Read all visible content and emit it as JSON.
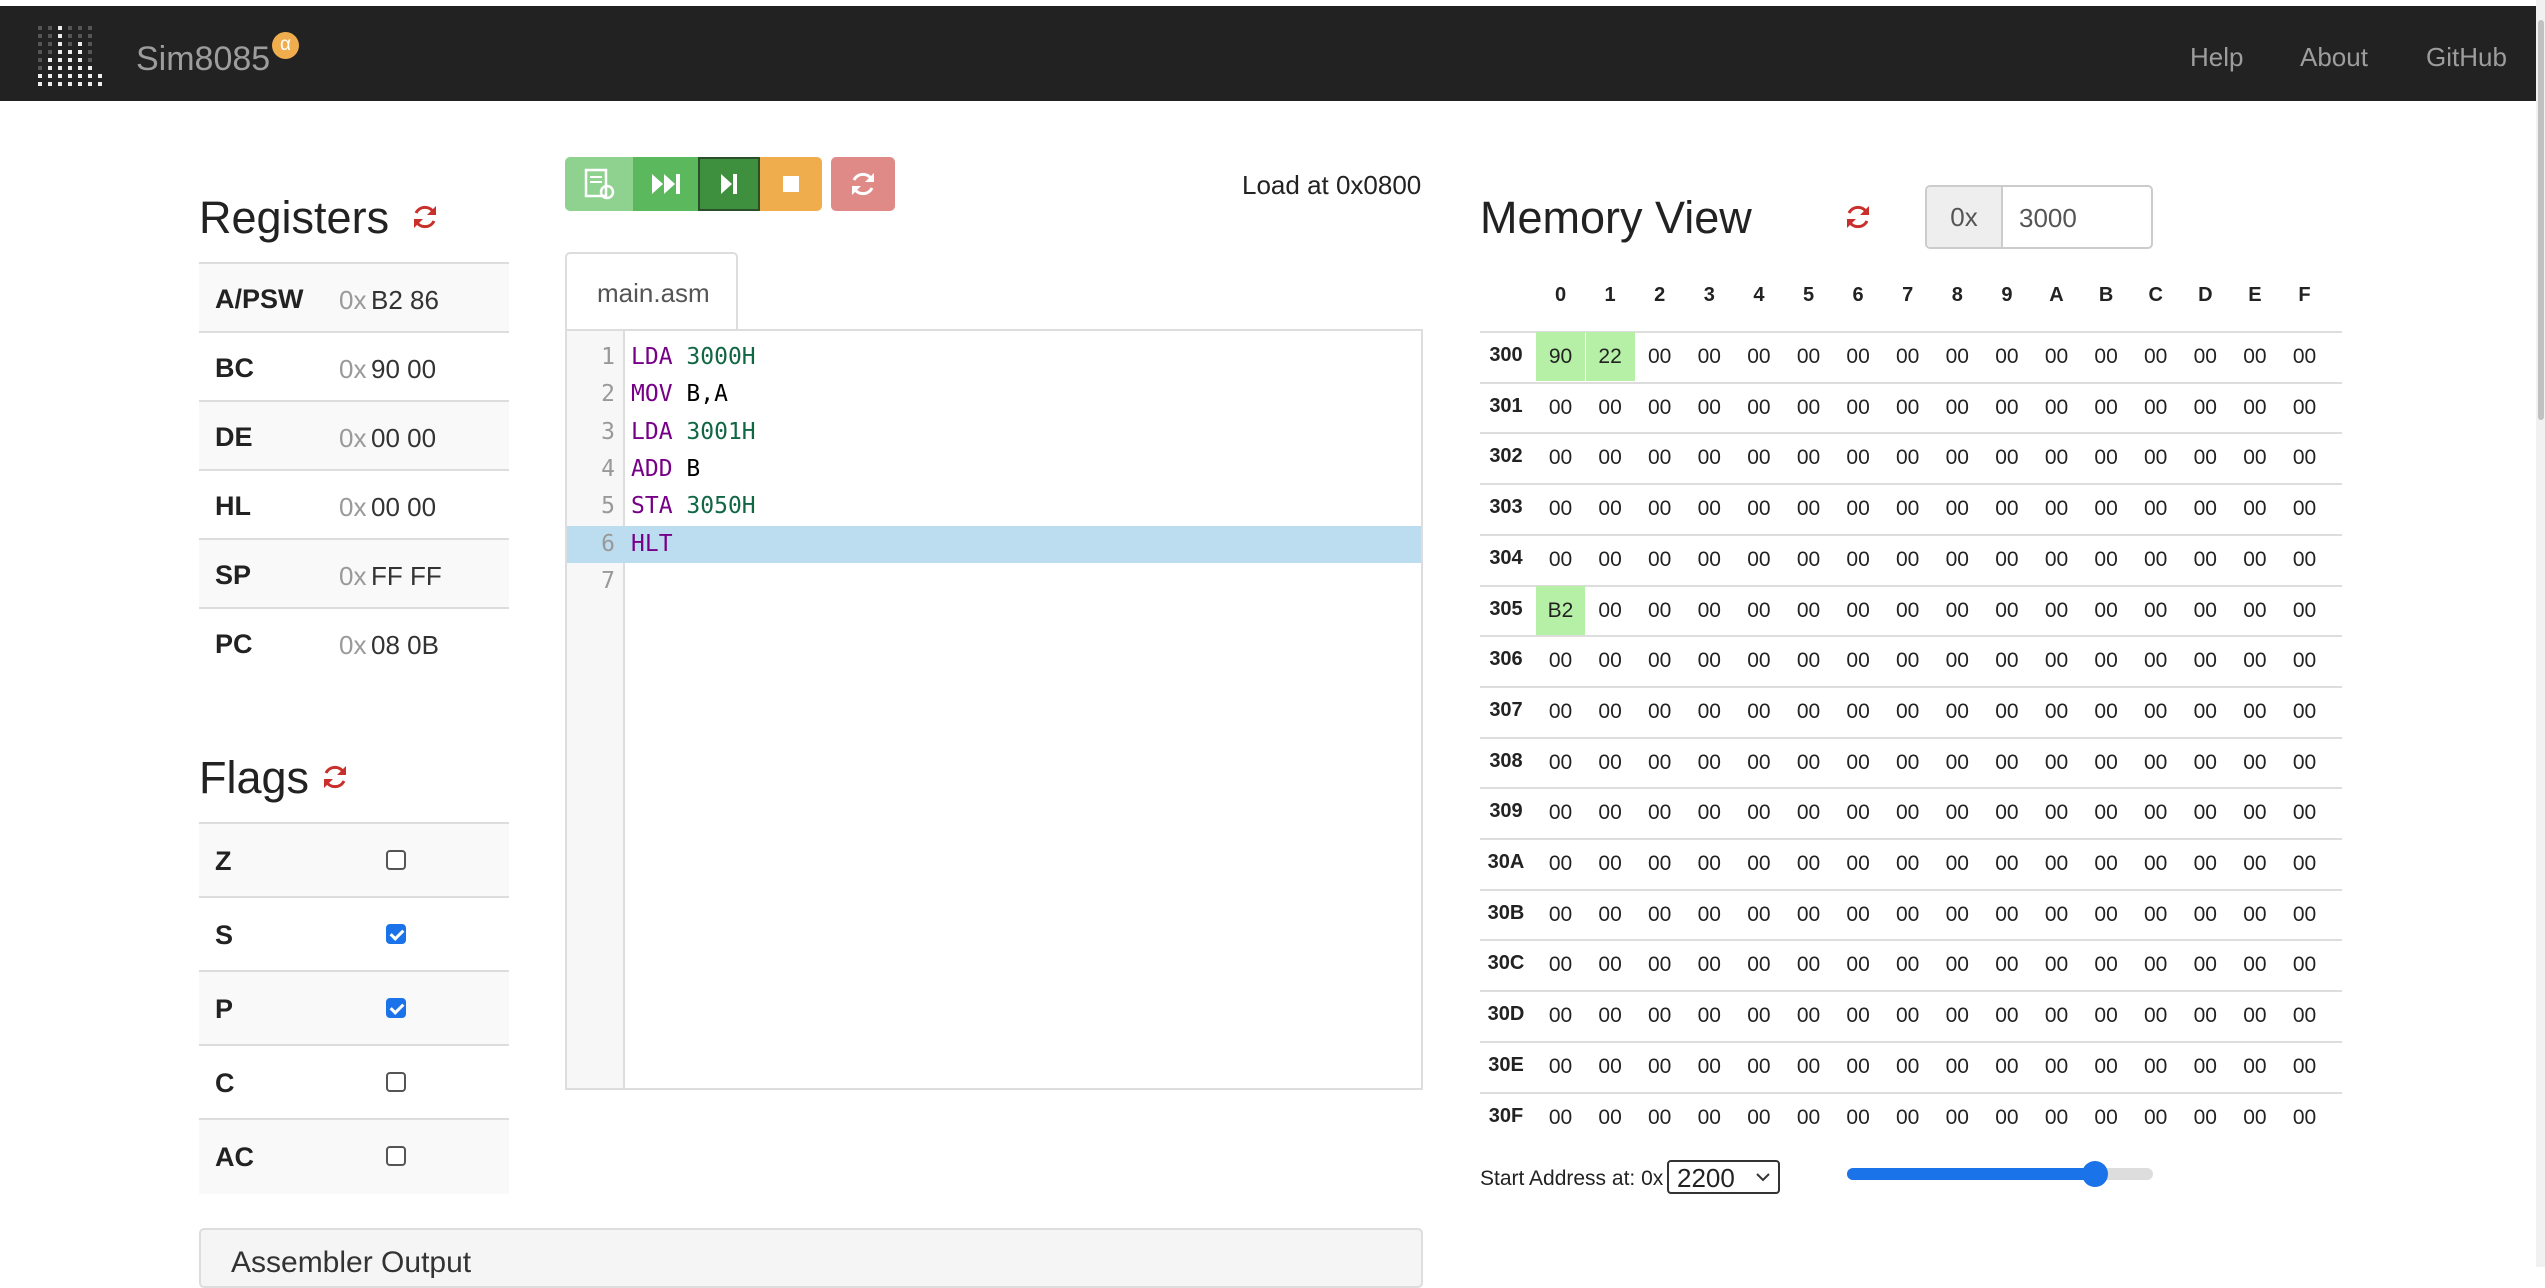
{
  "nav": {
    "brand": "Sim8085",
    "badge": "α",
    "links": [
      "Help",
      "About",
      "GitHub"
    ]
  },
  "registers": {
    "title": "Registers",
    "prefix": "0x",
    "rows": [
      {
        "name": "A/PSW",
        "value": "B2 86"
      },
      {
        "name": "BC",
        "value": "90 00"
      },
      {
        "name": "DE",
        "value": "00 00"
      },
      {
        "name": "HL",
        "value": "00 00"
      },
      {
        "name": "SP",
        "value": "FF FF"
      },
      {
        "name": "PC",
        "value": "08 0B"
      }
    ]
  },
  "flags": {
    "title": "Flags",
    "rows": [
      {
        "name": "Z",
        "checked": false
      },
      {
        "name": "S",
        "checked": true
      },
      {
        "name": "P",
        "checked": true
      },
      {
        "name": "C",
        "checked": false
      },
      {
        "name": "AC",
        "checked": false
      }
    ]
  },
  "toolbar": {
    "load_at": "Load at 0x0800",
    "buttons": [
      {
        "name": "assemble-button",
        "icon": "assemble-icon",
        "color": "#8fd18f"
      },
      {
        "name": "run-button",
        "icon": "fast-forward-icon",
        "color": "#5cb85c"
      },
      {
        "name": "step-button",
        "icon": "step-icon",
        "color": "#3e8f3e"
      },
      {
        "name": "stop-button",
        "icon": "stop-icon",
        "color": "#f0ad4e"
      },
      {
        "name": "reset-button",
        "icon": "refresh-icon",
        "color": "#e08a88"
      }
    ]
  },
  "editor": {
    "tab": "main.asm",
    "active_line": 6,
    "lines": [
      {
        "n": "1",
        "op": "LDA",
        "arg": "3000H",
        "argtype": "num"
      },
      {
        "n": "2",
        "op": "MOV",
        "arg": "B,A",
        "argtype": "plain"
      },
      {
        "n": "3",
        "op": "LDA",
        "arg": "3001H",
        "argtype": "num"
      },
      {
        "n": "4",
        "op": "ADD",
        "arg": "B",
        "argtype": "plain"
      },
      {
        "n": "5",
        "op": "STA",
        "arg": "3050H",
        "argtype": "num"
      },
      {
        "n": "6",
        "op": "HLT",
        "arg": "",
        "argtype": "plain"
      },
      {
        "n": "7",
        "op": "",
        "arg": "",
        "argtype": "plain"
      }
    ]
  },
  "memory": {
    "title": "Memory View",
    "addr_prefix": "0x",
    "addr_value": "3000",
    "col_headers": [
      "0",
      "1",
      "2",
      "3",
      "4",
      "5",
      "6",
      "7",
      "8",
      "9",
      "A",
      "B",
      "C",
      "D",
      "E",
      "F"
    ],
    "rows": [
      "300",
      "301",
      "302",
      "303",
      "304",
      "305",
      "306",
      "307",
      "308",
      "309",
      "30A",
      "30B",
      "30C",
      "30D",
      "30E",
      "30F"
    ],
    "default_value": "00",
    "special": [
      {
        "row": "300",
        "col": "0",
        "value": "90"
      },
      {
        "row": "300",
        "col": "1",
        "value": "22"
      },
      {
        "row": "305",
        "col": "0",
        "value": "B2"
      }
    ],
    "start_label": "Start Address at: 0x",
    "start_value": "2200",
    "slider_level": 0.81
  },
  "assembler": {
    "title": "Assembler Output"
  },
  "colors": {
    "navbar": "#222222",
    "highlight": "#b6f0a6",
    "active_line": "#bcdcf0",
    "refresh": "#c9302c"
  }
}
